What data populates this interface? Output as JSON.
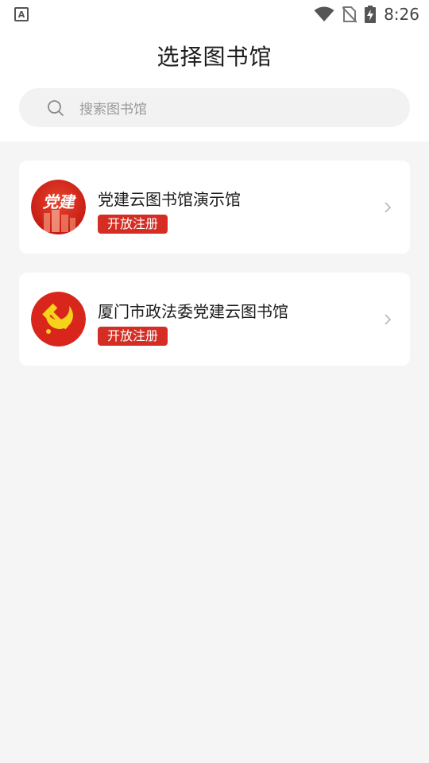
{
  "status_bar": {
    "notification_glyph": "A",
    "time": "8:26",
    "icons": [
      "wifi-icon",
      "no-sim-icon",
      "battery-charging-icon"
    ]
  },
  "header": {
    "title": "选择图书馆"
  },
  "search": {
    "placeholder": "搜索图书馆",
    "icon": "search-icon"
  },
  "libraries": [
    {
      "name": "党建云图书馆演示馆",
      "badge": "开放注册",
      "logo_text": "党建",
      "logo_icon": "dangjian-logo-icon"
    },
    {
      "name": "厦门市政法委党建云图书馆",
      "badge": "开放注册",
      "logo_icon": "hammer-sickle-icon"
    }
  ],
  "colors": {
    "badge_bg": "#d42e24",
    "page_bg": "#f5f5f5",
    "card_bg": "#ffffff"
  }
}
